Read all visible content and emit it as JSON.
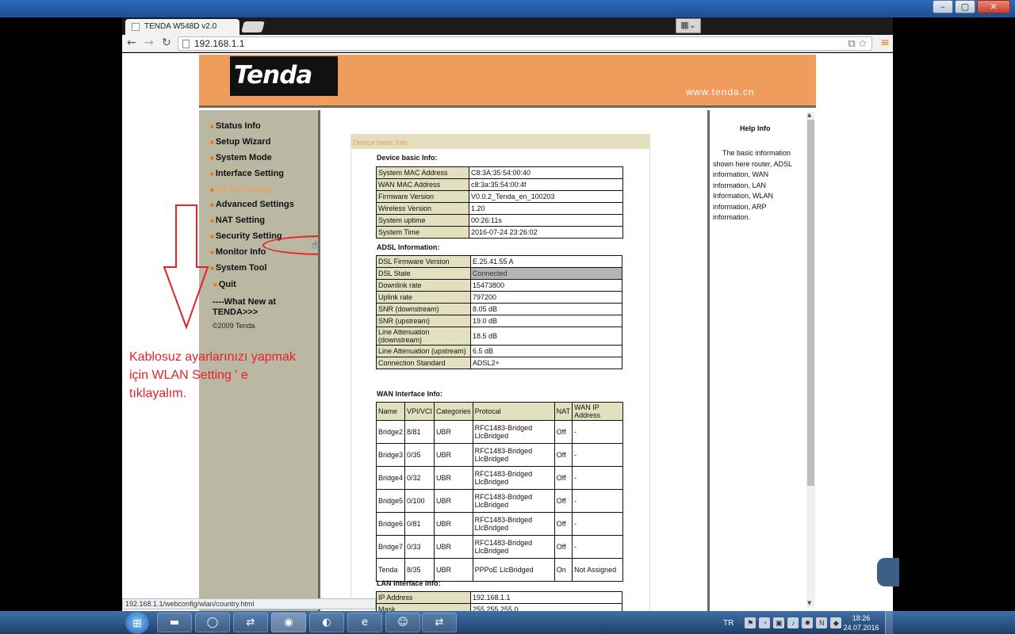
{
  "browser": {
    "tab_title": "TENDA W548D v2.0",
    "address": "192.168.1.1",
    "status_url": "192.168.1.1/webconfig/wlan/country.html"
  },
  "header": {
    "logo": "Tenda",
    "site": "www.tenda.cn"
  },
  "sidebar": {
    "items": [
      {
        "label": "Status Info"
      },
      {
        "label": "Setup Wizard"
      },
      {
        "label": "System Mode"
      },
      {
        "label": "Interface Setting"
      },
      {
        "label": "WLAN Setting"
      },
      {
        "label": "Advanced Settings"
      },
      {
        "label": "NAT Setting"
      },
      {
        "label": "Security Setting"
      },
      {
        "label": "Monitor Info"
      },
      {
        "label": "System Tool"
      },
      {
        "label": "Quit"
      }
    ],
    "whats_new": "----What New at TENDA>>>",
    "copyright": "©2009 Tenda"
  },
  "content": {
    "box_title": "Device basic Info",
    "device_heading": "Device basic Info:",
    "device": [
      {
        "k": "System MAC Address",
        "v": "C8:3A:35:54:00:40"
      },
      {
        "k": "WAN MAC Address",
        "v": "c8:3a:35:54:00:4f"
      },
      {
        "k": "Firmware Version",
        "v": "V0.0.2_Tenda_en_100203"
      },
      {
        "k": "Wireless Version",
        "v": "1.20"
      },
      {
        "k": "System uptime",
        "v": "00:26:11s"
      },
      {
        "k": "System Time",
        "v": "2016-07-24 23:26:02"
      }
    ],
    "adsl_heading": "ADSL Information:",
    "adsl": [
      {
        "k": "DSL Firmware Version",
        "v": "E.25.41.55 A"
      },
      {
        "k": "DSL State",
        "v": "Connected"
      },
      {
        "k": "Downlink rate",
        "v": "15473800"
      },
      {
        "k": "Uplink rate",
        "v": "797200"
      },
      {
        "k": "SNR (downstream)",
        "v": "8.05 dB"
      },
      {
        "k": "SNR (upstream)",
        "v": "19.0 dB"
      },
      {
        "k": "Line Attenuation (downstream)",
        "v": "18.5 dB"
      },
      {
        "k": "Line Attenuation (upstream)",
        "v": "6.5 dB"
      },
      {
        "k": "Connection Standard",
        "v": "ADSL2+"
      }
    ],
    "wan_heading": "WAN Interface Info:",
    "wan_headers": [
      "Name",
      "VPI/VCI",
      "Categories",
      "Protocal",
      "NAT",
      "WAN IP Address"
    ],
    "wan_rows": [
      [
        "Bridge2",
        "8/81",
        "UBR",
        "RFC1483-Bridged LlcBridged",
        "Off",
        "-"
      ],
      [
        "Bridge3",
        "0/35",
        "UBR",
        "RFC1483-Bridged LlcBridged",
        "Off",
        "-"
      ],
      [
        "Bridge4",
        "0/32",
        "UBR",
        "RFC1483-Bridged LlcBridged",
        "Off",
        "-"
      ],
      [
        "Bridge5",
        "0/100",
        "UBR",
        "RFC1483-Bridged LlcBridged",
        "Off",
        "-"
      ],
      [
        "Bridge6",
        "0/81",
        "UBR",
        "RFC1483-Bridged LlcBridged",
        "Off",
        "-"
      ],
      [
        "Bridge7",
        "0/33",
        "UBR",
        "RFC1483-Bridged LlcBridged",
        "Off",
        "-"
      ],
      [
        "Tenda",
        "8/35",
        "UBR",
        "PPPoE LlcBridged",
        "On",
        "Not Assigned"
      ]
    ],
    "lan_heading": "LAN Interface Info:",
    "lan": [
      {
        "k": "IP Address",
        "v": "192.168.1.1"
      },
      {
        "k": "Mask",
        "v": "255.255.255.0"
      }
    ]
  },
  "help": {
    "title": "Help Info",
    "text": "The basic information shown here router, ADSL information, WAN information, LAN Information, WLAN information, ARP information."
  },
  "annotation": {
    "text": "Kablosuz ayarlarınızı yapmak için WLAN Setting ' e tıklayalım."
  },
  "taskbar": {
    "lang": "TR",
    "time": "18:26",
    "date": "24.07.2016"
  },
  "colors": {
    "accent": "#ef9c5c",
    "sidebar": "#bab8a3",
    "annotation": "#e8202a"
  }
}
